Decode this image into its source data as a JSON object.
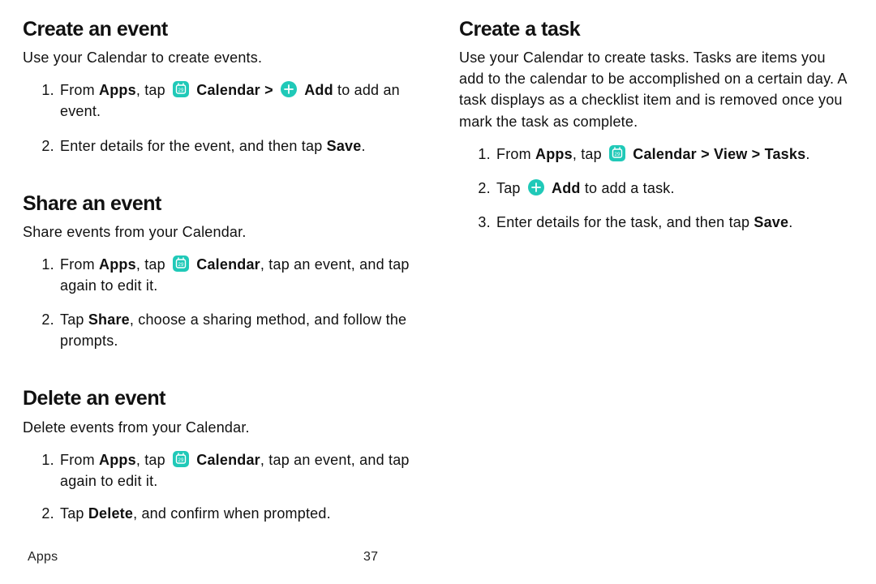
{
  "colors": {
    "accent": "#20c9b8",
    "text": "#111111"
  },
  "footer": {
    "section": "Apps",
    "page": "37"
  },
  "left": {
    "create_event": {
      "title": "Create an event",
      "intro": "Use your Calendar to create events.",
      "steps": {
        "s1": {
          "pre": "From ",
          "apps": "Apps",
          "mid1": ", tap ",
          "calendar_path": "Calendar > ",
          "add": "Add",
          "post": " to add an event."
        },
        "s2": {
          "pre": "Enter details for the event, and then tap ",
          "save": "Save",
          "post": "."
        }
      }
    },
    "share_event": {
      "title": "Share an event",
      "intro": "Share events from your Calendar.",
      "steps": {
        "s1": {
          "pre": "From ",
          "apps": "Apps",
          "mid1": ", tap ",
          "calendar": "Calendar",
          "post": ", tap an event, and tap again to edit it."
        },
        "s2": {
          "pre": "Tap ",
          "share": "Share",
          "post": ", choose a sharing method, and follow the prompts."
        }
      }
    },
    "delete_event": {
      "title": "Delete an event",
      "intro": "Delete events from your Calendar.",
      "steps": {
        "s1": {
          "pre": "From ",
          "apps": "Apps",
          "mid1": ", tap ",
          "calendar": "Calendar",
          "post": ", tap an event, and tap again to edit it."
        },
        "s2": {
          "pre": "Tap ",
          "delete": "Delete",
          "post": ", and confirm when prompted."
        }
      }
    }
  },
  "right": {
    "create_task": {
      "title": "Create a task",
      "intro": "Use your Calendar to create tasks. Tasks are items you add to the calendar to be accomplished on a certain day. A task displays as a checklist item and is removed once you mark the task as complete.",
      "steps": {
        "s1": {
          "pre": "From ",
          "apps": "Apps",
          "mid1": ", tap ",
          "path": "Calendar > View > Tasks",
          "post": "."
        },
        "s2": {
          "pre": "Tap ",
          "add": "Add",
          "post": " to add a task."
        },
        "s3": {
          "pre": "Enter details for the task, and then tap ",
          "save": "Save",
          "post": "."
        }
      }
    }
  }
}
